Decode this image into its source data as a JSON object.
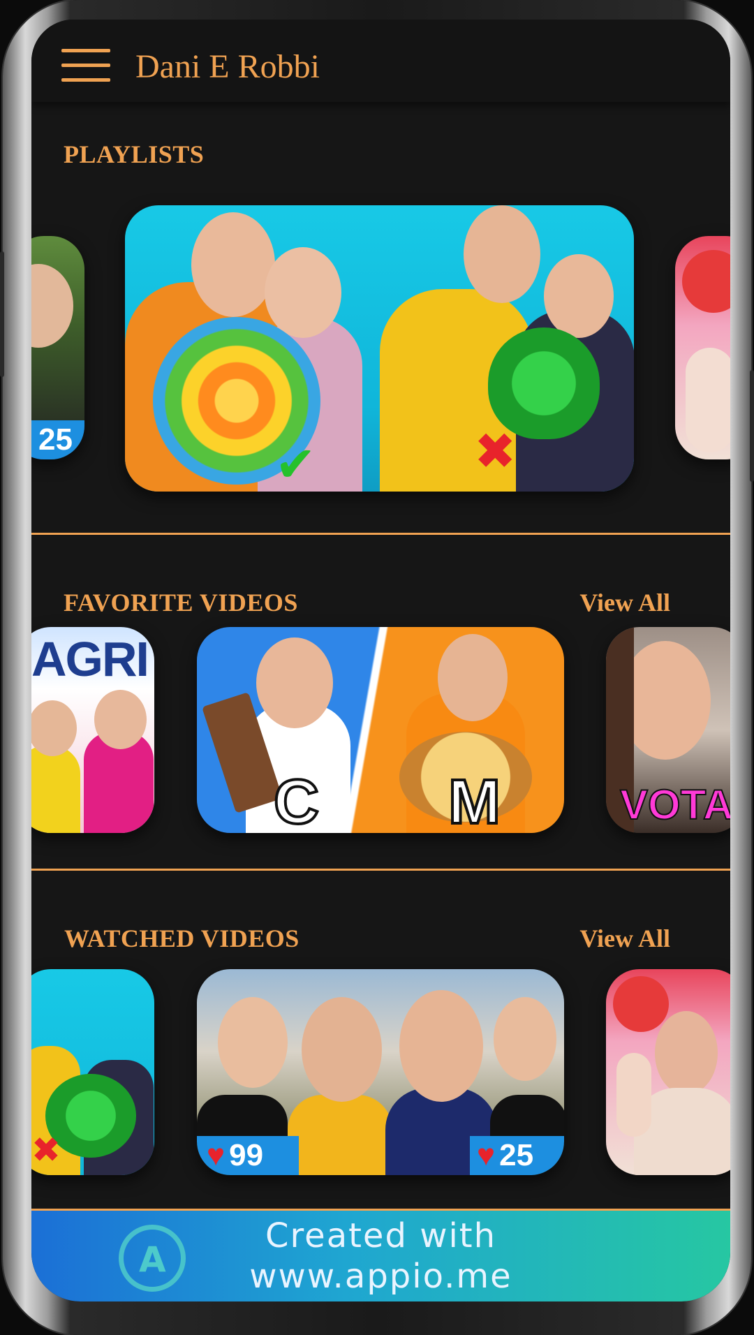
{
  "app": {
    "title": "Dani E Robbi"
  },
  "sections": {
    "playlists": {
      "title": "PLAYLISTS"
    },
    "favorites": {
      "title": "FAVORITE VIDEOS",
      "view_all": "View All"
    },
    "watched": {
      "title": "WATCHED VIDEOS",
      "view_all": "View All"
    }
  },
  "thumbnails": {
    "playlist_left_badge": "25",
    "fav_left_text": "AGRI",
    "fav_center_left_letter": "C",
    "fav_center_right_letter": "M",
    "fav_right_text": "VOTA!",
    "watched_center_left_badge": "99",
    "watched_center_right_badge": "25"
  },
  "banner": {
    "line1": "Created with",
    "line2": "www.appio.me"
  },
  "colors": {
    "accent": "#f0a252",
    "background": "#161616",
    "appbar": "#141414"
  },
  "icons": {
    "menu": "hamburger-menu-icon",
    "brand": "appio-logo-icon",
    "heart": "heart-icon",
    "broken_heart": "broken-heart-icon"
  }
}
